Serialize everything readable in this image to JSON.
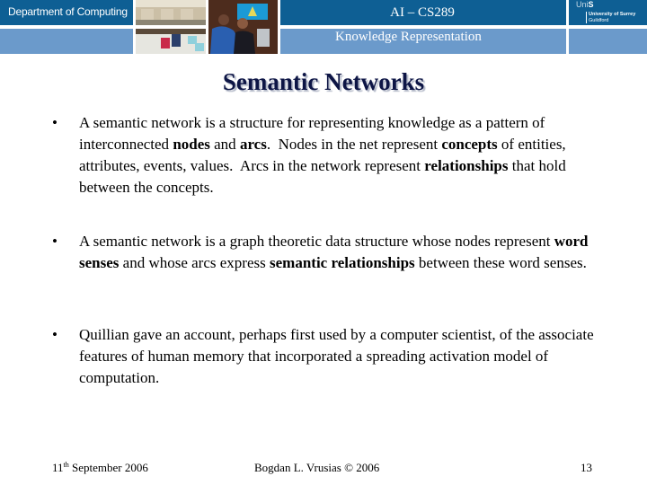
{
  "header": {
    "department": "Department of Computing",
    "course": "AI – CS289",
    "subject": "Knowledge Representation",
    "logo": {
      "uni": "Uni",
      "s": "S",
      "line1": "University of Surrey",
      "line2": "Guildford"
    },
    "colors": {
      "dark_band": "#0e5f94",
      "light_band": "#6b9acb"
    },
    "photos": [
      "computer-lab-photo",
      "students-at-screen-photo"
    ]
  },
  "slide": {
    "title": "Semantic Networks",
    "title_color": "#0d1545",
    "bullets": [
      {
        "segments": [
          {
            "text": "A semantic network is a structure for representing knowledge as a pattern of interconnected ",
            "bold": false
          },
          {
            "text": "nodes",
            "bold": true
          },
          {
            "text": " and ",
            "bold": false
          },
          {
            "text": "arcs",
            "bold": true
          },
          {
            "text": ".  Nodes in the net represent ",
            "bold": false
          },
          {
            "text": "concepts",
            "bold": true
          },
          {
            "text": " of entities, attributes, events, values.  Arcs in the network represent ",
            "bold": false
          },
          {
            "text": "relationships",
            "bold": true
          },
          {
            "text": " that hold between the concepts.",
            "bold": false
          }
        ]
      },
      {
        "segments": [
          {
            "text": "A semantic network is a graph theoretic data structure whose nodes represent ",
            "bold": false
          },
          {
            "text": "word senses",
            "bold": true
          },
          {
            "text": " and whose arcs express ",
            "bold": false
          },
          {
            "text": "semantic relationships",
            "bold": true
          },
          {
            "text": " between these word senses.",
            "bold": false
          }
        ]
      },
      {
        "segments": [
          {
            "text": "Quillian gave an account, perhaps first used by a computer scientist, of the associate features of human memory that incorporated a spreading activation model of computation.",
            "bold": false
          }
        ]
      }
    ],
    "bullet_glyph": "•"
  },
  "footer": {
    "date_day": "11",
    "date_suffix": "th",
    "date_rest": " September 2006",
    "author": "Bogdan L. Vrusias © 2006",
    "page": "13"
  }
}
